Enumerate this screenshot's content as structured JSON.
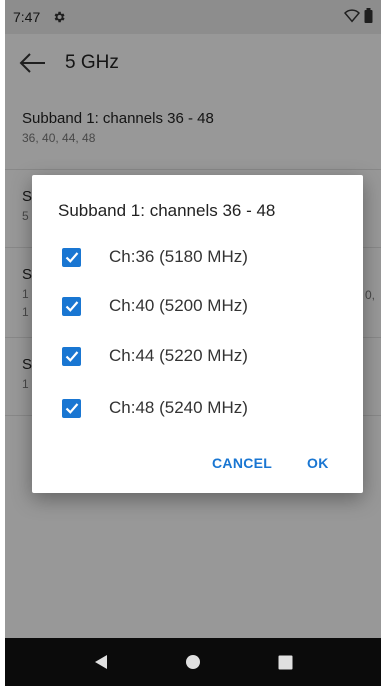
{
  "status_bar": {
    "time": "7:47",
    "icons": [
      "settings-gear-icon",
      "wifi-icon",
      "battery-icon"
    ]
  },
  "app_bar": {
    "title": "5 GHz",
    "back_icon": "arrow-back-icon"
  },
  "list": {
    "items": [
      {
        "title": "Subband 1: channels 36 - 48",
        "summary": "36, 40, 44, 48"
      },
      {
        "title": "S",
        "summary": "5"
      },
      {
        "title": "S",
        "summary": "1",
        "summary2": "1",
        "summary_right": "0,"
      },
      {
        "title": "S",
        "summary": "1"
      }
    ]
  },
  "dialog": {
    "title": "Subband 1: channels 36 - 48",
    "options": [
      {
        "label": "Ch:36 (5180 MHz)",
        "checked": true
      },
      {
        "label": "Ch:40 (5200 MHz)",
        "checked": true
      },
      {
        "label": "Ch:44 (5220 MHz)",
        "checked": true
      },
      {
        "label": "Ch:48 (5240 MHz)",
        "checked": true
      }
    ],
    "cancel_label": "CANCEL",
    "ok_label": "OK"
  },
  "nav_bar": {
    "icons": [
      "back-triangle-icon",
      "home-circle-icon",
      "recents-square-icon"
    ]
  },
  "colors": {
    "accent": "#1976d2",
    "status_bar_bg": "#e4e4e4",
    "nav_bar_bg": "#0b0b0b",
    "scrim": "rgba(0,0,0,0.38)"
  }
}
